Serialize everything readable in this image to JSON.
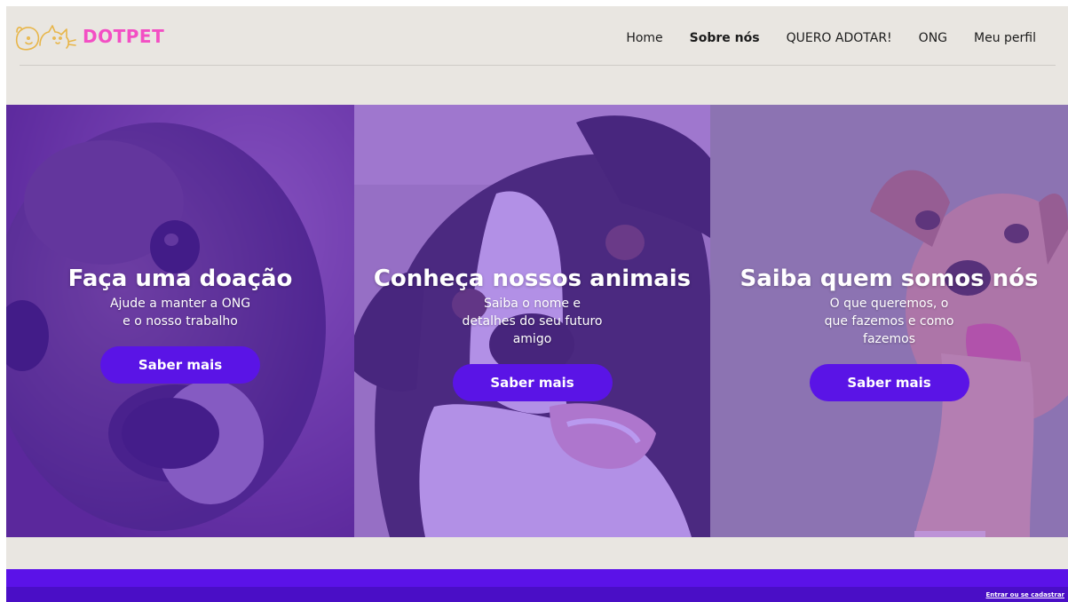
{
  "brand": {
    "name": "DOTPET",
    "name_color": "#f34fc4",
    "mark_icon": "dog-cat-outline-icon",
    "mark_color": "#e8b64a"
  },
  "nav": {
    "items": [
      {
        "label": "Home",
        "active": false
      },
      {
        "label": "Sobre nós",
        "active": true
      },
      {
        "label": "QUERO ADOTAR!",
        "active": false
      },
      {
        "label": "ONG",
        "active": false
      },
      {
        "label": "Meu perfil",
        "active": false
      }
    ]
  },
  "panels": [
    {
      "title": "Faça uma doação",
      "description": "Ajude a manter a ONG\ne o nosso trabalho",
      "button": "Saber mais",
      "image": "dog-closeup-photo"
    },
    {
      "title": "Conheça nossos animais",
      "description": "Saiba o nome e\ndetalhes do seu futuro\namigo",
      "button": "Saber mais",
      "image": "black-white-dog-photo"
    },
    {
      "title": "Saiba quem somos nós",
      "description": "O que queremos, o\nque fazemos e como\nfazemos",
      "button": "Saber mais",
      "image": "tan-dog-on-grass-photo"
    }
  ],
  "footer": {
    "link": "Entrar ou se cadastrar"
  },
  "colors": {
    "background": "#e9e6e1",
    "accent": "#5a14e6",
    "footer": "#5b12e8"
  }
}
